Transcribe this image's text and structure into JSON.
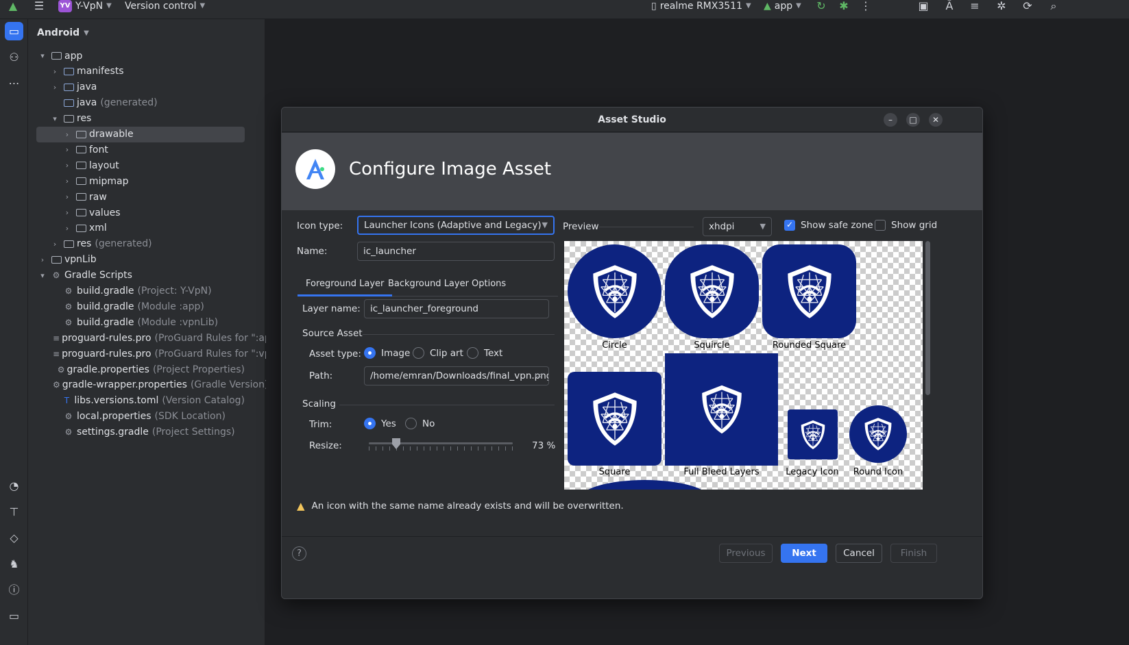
{
  "topbar": {
    "project_badge": "YV",
    "project_name": "Y-VpN",
    "vcs": "Version control",
    "device": "realme RMX3511",
    "run_config": "app"
  },
  "sidebar_panel": {
    "title": "Android",
    "items": [
      {
        "label": "app",
        "muted": ""
      },
      {
        "label": "manifests",
        "muted": ""
      },
      {
        "label": "java",
        "muted": ""
      },
      {
        "label": "java",
        "muted": "(generated)"
      },
      {
        "label": "res",
        "muted": ""
      },
      {
        "label": "drawable",
        "muted": ""
      },
      {
        "label": "font",
        "muted": ""
      },
      {
        "label": "layout",
        "muted": ""
      },
      {
        "label": "mipmap",
        "muted": ""
      },
      {
        "label": "raw",
        "muted": ""
      },
      {
        "label": "values",
        "muted": ""
      },
      {
        "label": "xml",
        "muted": ""
      },
      {
        "label": "res",
        "muted": "(generated)"
      },
      {
        "label": "vpnLib",
        "muted": ""
      },
      {
        "label": "Gradle Scripts",
        "muted": ""
      },
      {
        "label": "build.gradle",
        "muted": "(Project: Y-VpN)"
      },
      {
        "label": "build.gradle",
        "muted": "(Module :app)"
      },
      {
        "label": "build.gradle",
        "muted": "(Module :vpnLib)"
      },
      {
        "label": "proguard-rules.pro",
        "muted": "(ProGuard Rules for \":ap"
      },
      {
        "label": "proguard-rules.pro",
        "muted": "(ProGuard Rules for \":vp"
      },
      {
        "label": "gradle.properties",
        "muted": "(Project Properties)"
      },
      {
        "label": "gradle-wrapper.properties",
        "muted": "(Gradle Version)"
      },
      {
        "label": "libs.versions.toml",
        "muted": "(Version Catalog)"
      },
      {
        "label": "local.properties",
        "muted": "(SDK Location)"
      },
      {
        "label": "settings.gradle",
        "muted": "(Project Settings)"
      }
    ]
  },
  "dialog": {
    "title": "Asset Studio",
    "heading": "Configure Image Asset",
    "icon_type_label": "Icon type:",
    "icon_type_value": "Launcher Icons (Adaptive and Legacy)",
    "name_label": "Name:",
    "name_value": "ic_launcher",
    "tabs": [
      "Foreground Layer",
      "Background Layer",
      "Options"
    ],
    "layer_name_label": "Layer name:",
    "layer_name_value": "ic_launcher_foreground",
    "source_asset_label": "Source Asset",
    "asset_type_label": "Asset type:",
    "asset_types": [
      "Image",
      "Clip art",
      "Text"
    ],
    "path_label": "Path:",
    "path_value": "/home/emran/Downloads/final_vpn.png",
    "scaling_label": "Scaling",
    "trim_label": "Trim:",
    "trim_options": [
      "Yes",
      "No"
    ],
    "resize_label": "Resize:",
    "resize_value": "73 %",
    "resize_percent": 73,
    "preview_label": "Preview",
    "density_value": "xhdpi",
    "show_safe_zone": "Show safe zone",
    "show_grid": "Show grid",
    "previews": [
      "Circle",
      "Squircle",
      "Rounded Square",
      "Square",
      "Full Bleed Layers",
      "Legacy Icon",
      "Round Icon"
    ],
    "warning": "An icon with the same name already exists and will be overwritten.",
    "buttons": {
      "previous": "Previous",
      "next": "Next",
      "cancel": "Cancel",
      "finish": "Finish"
    },
    "help": "?"
  },
  "colors": {
    "accent": "#3574f0",
    "icon_bg": "#0d2380",
    "warning": "#f2c55c"
  }
}
